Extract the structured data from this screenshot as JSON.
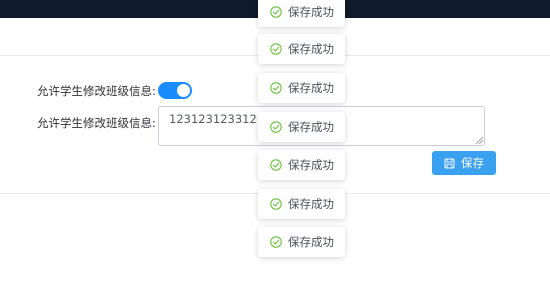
{
  "form": {
    "switch_label": "允许学生修改班级信息:",
    "switch_on": true,
    "textarea_label": "允许学生修改班级信息:",
    "textarea_value": "123123123312",
    "save_label": "保存"
  },
  "toasts": [
    {
      "text": "保存成功"
    },
    {
      "text": "保存成功"
    },
    {
      "text": "保存成功"
    },
    {
      "text": "保存成功"
    },
    {
      "text": "保存成功"
    },
    {
      "text": "保存成功"
    },
    {
      "text": "保存成功"
    }
  ],
  "colors": {
    "header_bg": "#0f1a2b",
    "accent": "#1a8cff",
    "button_bg": "#3aa0f0",
    "success": "#67c23a"
  },
  "icons": {
    "toast": "check-circle-icon",
    "save": "save-icon"
  }
}
